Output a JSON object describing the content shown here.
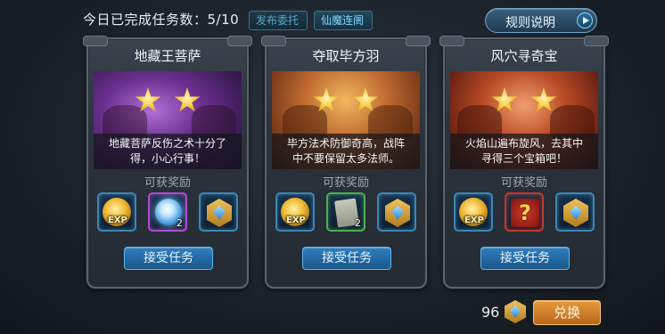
{
  "header": {
    "progress_label": "今日已完成任务数：5/10",
    "tabs": [
      {
        "label": "发布委托",
        "active": false
      },
      {
        "label": "仙魔连阓",
        "active": true
      }
    ],
    "rules_button": "规则说明"
  },
  "cards": [
    {
      "title": "地藏王菩萨",
      "stars": 2,
      "description_line1": "地藏菩萨反伤之术十分了",
      "description_line2": "得，小心行事！",
      "reward_label": "可获奖励",
      "rewards": [
        {
          "icon": "exp-icon",
          "text": "EXP",
          "count": ""
        },
        {
          "icon": "orb-icon",
          "count": "2"
        },
        {
          "icon": "crest-icon",
          "count": ""
        }
      ],
      "accept_label": "接受任务"
    },
    {
      "title": "夺取毕方羽",
      "stars": 2,
      "description_line1": "毕方法术防御奇高，战阵",
      "description_line2": "中不要保留太多法师。",
      "reward_label": "可获奖励",
      "rewards": [
        {
          "icon": "exp-icon",
          "text": "EXP",
          "count": ""
        },
        {
          "icon": "scroll-icon",
          "count": "2"
        },
        {
          "icon": "crest-icon",
          "count": ""
        }
      ],
      "accept_label": "接受任务"
    },
    {
      "title": "风穴寻奇宝",
      "stars": 2,
      "description_line1": "火焰山遍布旋风，去其中",
      "description_line2": "寻得三个宝箱吧！",
      "reward_label": "可获奖励",
      "rewards": [
        {
          "icon": "exp-icon",
          "text": "EXP",
          "count": ""
        },
        {
          "icon": "mystery-box-icon",
          "count": ""
        },
        {
          "icon": "crest-icon",
          "count": ""
        }
      ],
      "accept_label": "接受任务"
    }
  ],
  "footer": {
    "currency_amount": "96",
    "currency_icon": "crest-icon",
    "exchange_button": "兑换"
  }
}
